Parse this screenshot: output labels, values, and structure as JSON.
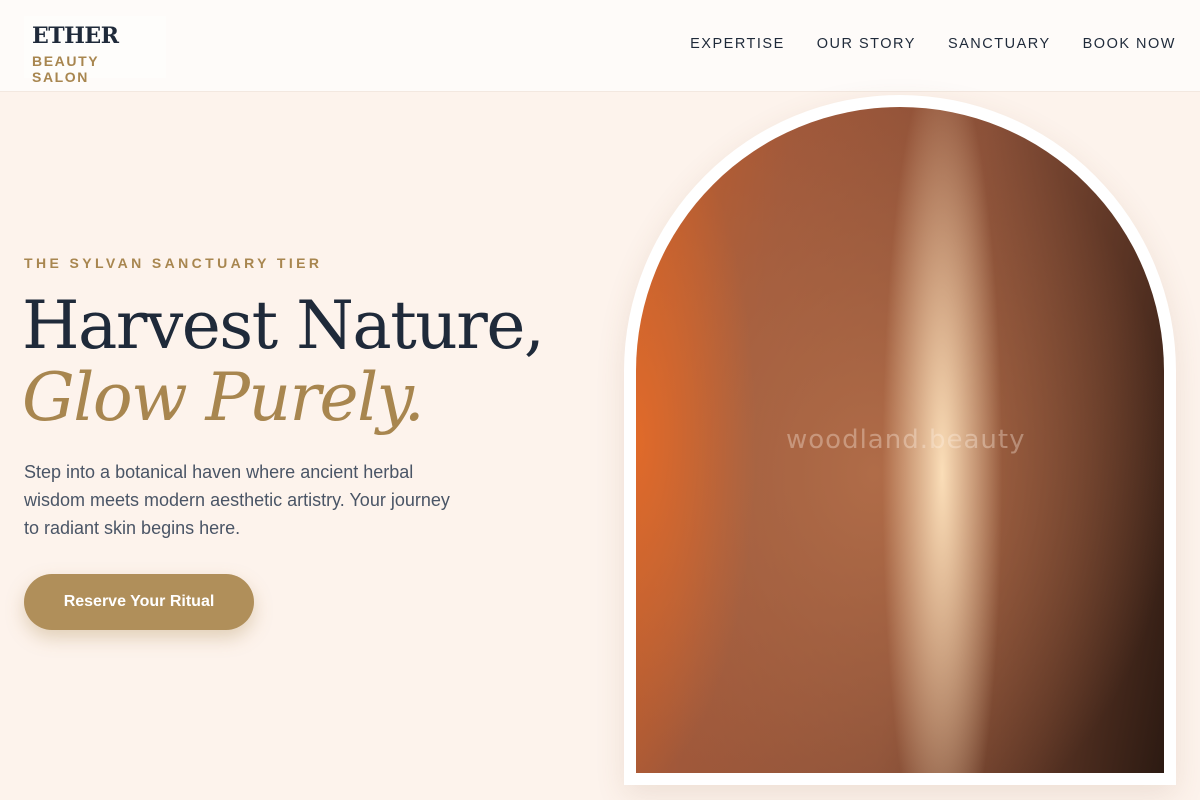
{
  "logo": {
    "title": "ETHER",
    "subtitle": "BEAUTY SALON"
  },
  "nav": {
    "items": [
      {
        "label": "EXPERTISE"
      },
      {
        "label": "OUR STORY"
      },
      {
        "label": "SANCTUARY"
      },
      {
        "label": "BOOK NOW"
      }
    ]
  },
  "hero": {
    "eyebrow": "THE SYLVAN SANCTUARY TIER",
    "headline_line1": "Harvest Nature,",
    "headline_line2": "Glow Purely.",
    "description": "Step into a botanical haven where ancient herbal wisdom meets modern aesthetic artistry. Your journey to radiant skin begins here.",
    "cta_label": "Reserve Your Ritual"
  },
  "image": {
    "watermark": "woodland.beauty"
  },
  "colors": {
    "background": "#fdf3ec",
    "accent": "#a8864f",
    "cta": "#b08f5a",
    "text_dark": "#1f2a3a"
  }
}
